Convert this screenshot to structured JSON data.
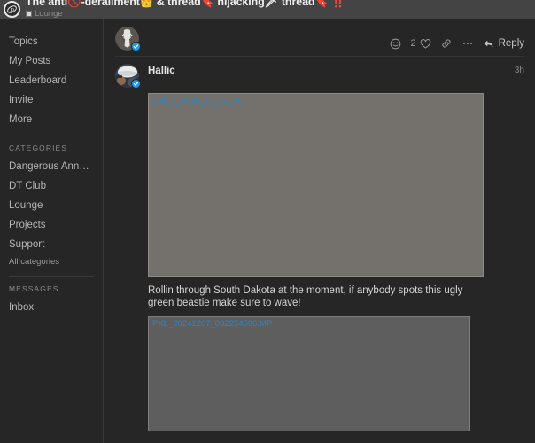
{
  "header": {
    "logo_icon": "forum-logo-icon",
    "thread_title_parts": [
      {
        "t": "The anti",
        "type": "text"
      },
      {
        "t": "🚫",
        "type": "emoji"
      },
      {
        "t": "-derailment",
        "type": "text"
      },
      {
        "t": "👑",
        "type": "emoji"
      },
      {
        "t": " & thread",
        "type": "text"
      },
      {
        "t": "🔖",
        "type": "emoji"
      },
      {
        "t": " hijacking",
        "type": "text"
      },
      {
        "t": "🗡",
        "type": "emoji"
      },
      {
        "t": " thread",
        "type": "text"
      },
      {
        "t": "🔖",
        "type": "emoji"
      },
      {
        "t": " ‼️",
        "type": "emoji"
      }
    ],
    "thread_title": "The anti🚫-derailment👑 & thread🔖 hijacking🗡 thread🔖 ‼️",
    "breadcrumb_category": "Lounge",
    "category_chip_color": "#d6d6d6"
  },
  "sidebar": {
    "primary_items": [
      {
        "label": "Topics",
        "name": "sidebar-item-topics"
      },
      {
        "label": "My Posts",
        "name": "sidebar-item-my-posts"
      },
      {
        "label": "Leaderboard",
        "name": "sidebar-item-leaderboard"
      },
      {
        "label": "Invite",
        "name": "sidebar-item-invite"
      },
      {
        "label": "More",
        "name": "sidebar-item-more"
      }
    ],
    "categories_heading": "CATEGORIES",
    "categories": [
      {
        "label": "Dangerous Announce...",
        "name": "sidebar-category-dangerous-announcements"
      },
      {
        "label": "DT Club",
        "name": "sidebar-category-dt-club"
      },
      {
        "label": "Lounge",
        "name": "sidebar-category-lounge"
      },
      {
        "label": "Projects",
        "name": "sidebar-category-projects"
      },
      {
        "label": "Support",
        "name": "sidebar-category-support"
      }
    ],
    "all_categories_label": "All categories",
    "messages_heading": "MESSAGES",
    "messages_items": [
      {
        "label": "Inbox",
        "name": "sidebar-item-inbox"
      }
    ]
  },
  "posts": [
    {
      "username": "",
      "timestamp": "",
      "verified": true,
      "actions": {
        "emoji_react_icon": "smiley-face-icon",
        "like_count": "2",
        "like_icon": "heart-icon",
        "link_icon": "link-chain-icon",
        "more_icon": "ellipsis-icon",
        "reply_label": "Reply",
        "reply_icon": "reply-arrow-icon"
      }
    },
    {
      "username": "Hallic",
      "timestamp": "3h",
      "verified": true,
      "attachments": [
        {
          "filename": "Dec_8_2024_17_43_36",
          "name": "attachment-image-1"
        },
        {
          "filename": "PXL_20241207_032254596.MP",
          "name": "attachment-image-2"
        }
      ],
      "text": "Rollin through South Dakota at the moment, if anybody spots this ugly green beastie make sure to wave!"
    }
  ],
  "colors": {
    "accent_blue": "#1d9bf0",
    "link_blue": "#2b87c4",
    "background": "#262626",
    "header_background": "#444444",
    "placeholder_1": "#74716d",
    "placeholder_2": "#5e5e5e"
  }
}
